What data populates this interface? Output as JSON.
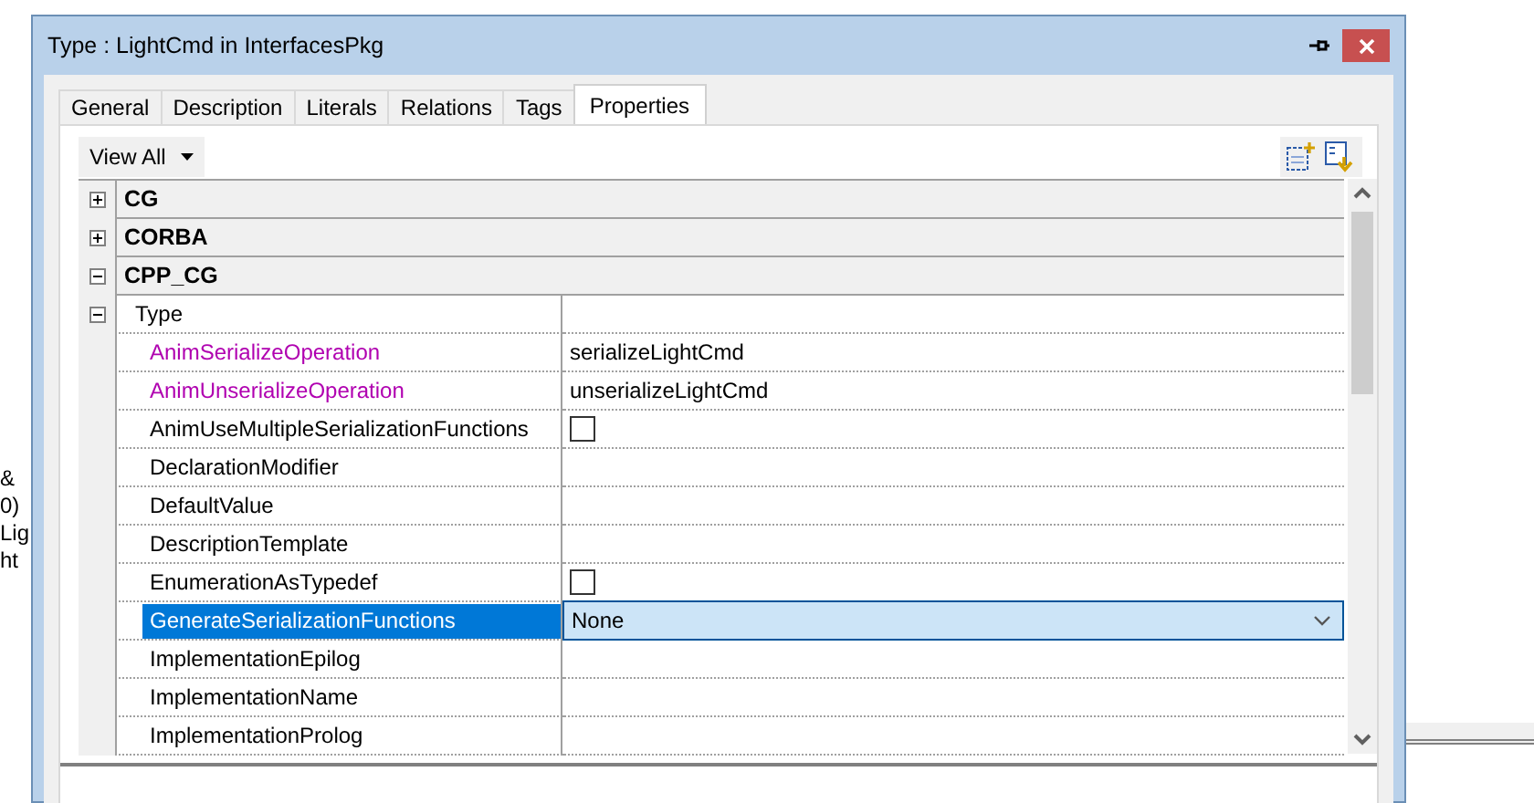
{
  "background": {
    "fragments": [
      "&",
      "0)",
      "Lig",
      "ht"
    ]
  },
  "window": {
    "title": "Type : LightCmd in InterfacesPkg"
  },
  "tabs": [
    {
      "label": "General",
      "selected": false
    },
    {
      "label": "Description",
      "selected": false
    },
    {
      "label": "Literals",
      "selected": false
    },
    {
      "label": "Relations",
      "selected": false
    },
    {
      "label": "Tags",
      "selected": false
    },
    {
      "label": "Properties",
      "selected": true
    }
  ],
  "toolbar": {
    "view_button": "View All"
  },
  "properties": [
    {
      "label": "CG",
      "expanded": false
    },
    {
      "label": "CORBA",
      "expanded": false
    },
    {
      "label": "CPP_CG",
      "expanded": true,
      "children": [
        {
          "label": "Type",
          "expanded": true,
          "children": [
            {
              "label": "AnimSerializeOperation",
              "modified": true,
              "kind": "text",
              "value": "serializeLightCmd",
              "selected": false
            },
            {
              "label": "AnimUnserializeOperation",
              "modified": true,
              "kind": "text",
              "value": "unserializeLightCmd",
              "selected": false
            },
            {
              "label": "AnimUseMultipleSerializationFunctions",
              "modified": false,
              "kind": "checkbox",
              "checked": false,
              "selected": false
            },
            {
              "label": "DeclarationModifier",
              "modified": false,
              "kind": "text",
              "selected": false
            },
            {
              "label": "DefaultValue",
              "modified": false,
              "kind": "text",
              "selected": false
            },
            {
              "label": "DescriptionTemplate",
              "modified": false,
              "kind": "text",
              "selected": false
            },
            {
              "label": "EnumerationAsTypedef",
              "modified": false,
              "kind": "checkbox",
              "checked": false,
              "selected": false
            },
            {
              "label": "GenerateSerializationFunctions",
              "modified": false,
              "kind": "dropdown",
              "value": "None",
              "selected": true
            },
            {
              "label": "ImplementationEpilog",
              "modified": false,
              "kind": "text",
              "selected": false
            },
            {
              "label": "ImplementationName",
              "modified": false,
              "kind": "text",
              "selected": false
            },
            {
              "label": "ImplementationProlog",
              "modified": false,
              "kind": "text",
              "selected": false
            }
          ]
        }
      ]
    }
  ]
}
